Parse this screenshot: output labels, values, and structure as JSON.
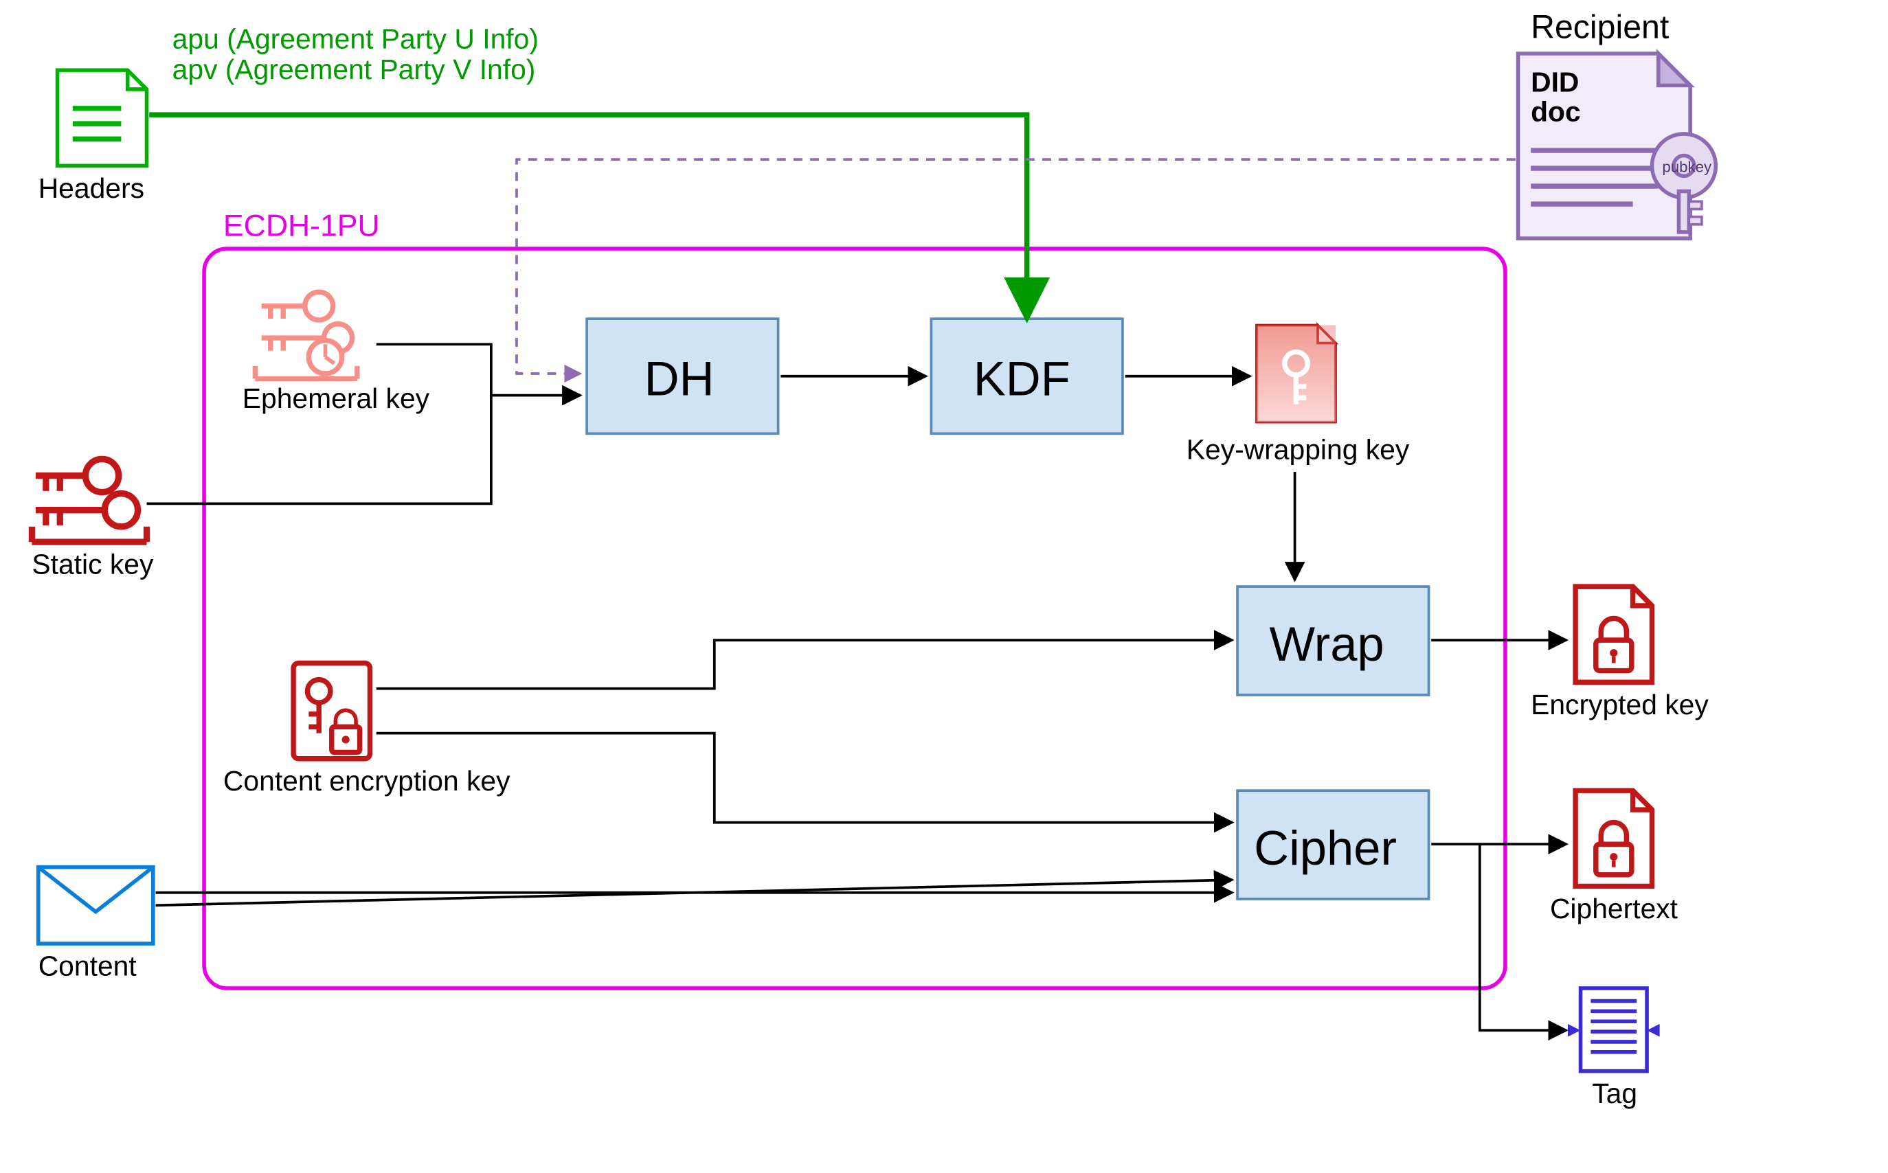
{
  "title": "ECDH-1PU",
  "headers": {
    "label": "Headers",
    "apu": "apu (Agreement Party U Info)",
    "apv": "apv (Agreement Party V Info)"
  },
  "recipient": {
    "title": "Recipient",
    "doc": "DID\ndoc",
    "pubkey": "pubkey"
  },
  "ephemeral": "Ephemeral key",
  "statickey": "Static key",
  "cek": "Content encryption  key",
  "content": "Content",
  "dh": "DH",
  "kdf": "KDF",
  "kwk": "Key-wrapping key",
  "wrap": "Wrap",
  "cipher": "Cipher",
  "enckey": "Encrypted key",
  "ciphertext": "Ciphertext",
  "tag": "Tag"
}
